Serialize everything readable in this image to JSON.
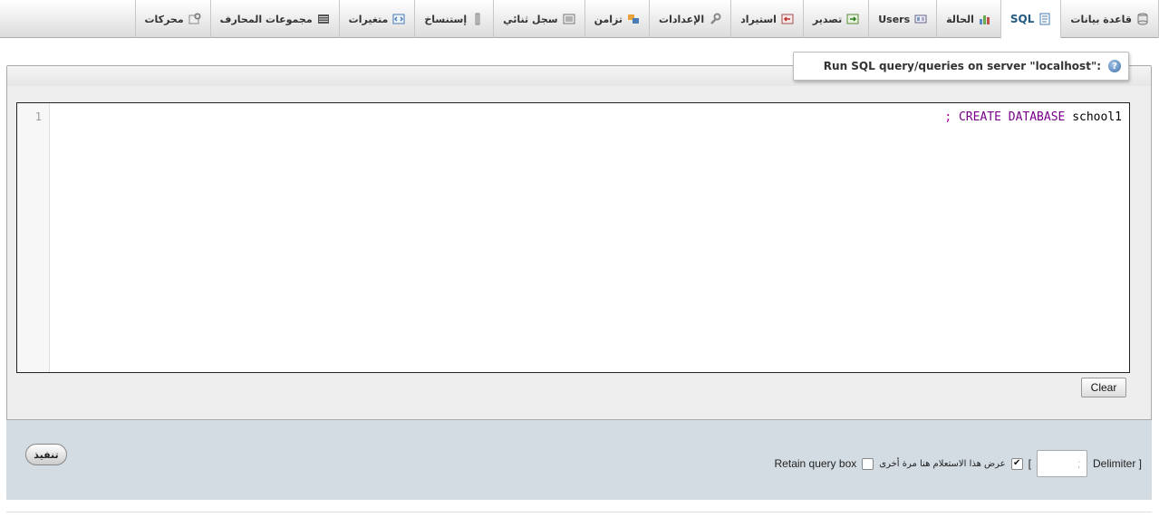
{
  "tabs": [
    {
      "label": "قاعدة بيانات",
      "icon": "database-icon",
      "active": false
    },
    {
      "label": "SQL",
      "icon": "sql-document-icon",
      "active": true
    },
    {
      "label": "الحالة",
      "icon": "status-chart-icon",
      "active": false
    },
    {
      "label": "Users",
      "icon": "users-icon",
      "active": false
    },
    {
      "label": "تصدير",
      "icon": "export-icon",
      "active": false
    },
    {
      "label": "استيراد",
      "icon": "import-icon",
      "active": false
    },
    {
      "label": "الإعدادات",
      "icon": "wrench-icon",
      "active": false
    },
    {
      "label": "تزامن",
      "icon": "sync-icon",
      "active": false
    },
    {
      "label": "سجل ثنائي",
      "icon": "binlog-icon",
      "active": false
    },
    {
      "label": "إستنساخ",
      "icon": "replication-icon",
      "active": false
    },
    {
      "label": "متغيرات",
      "icon": "variables-icon",
      "active": false
    },
    {
      "label": "مجموعات المحارف",
      "icon": "charsets-icon",
      "active": false
    },
    {
      "label": "محركات",
      "icon": "engines-icon",
      "active": false
    }
  ],
  "query_box": {
    "legend": ":\"Run SQL query/queries on server \"localhost",
    "help_glyph": "?",
    "line_numbers": [
      "1"
    ],
    "code": {
      "semicolon": ";",
      "keyword": "CREATE DATABASE",
      "identifier": "school1"
    },
    "clear_label": "Clear"
  },
  "footer": {
    "delimiter_label_open": "[ Delimiter",
    "delimiter_value": ";",
    "bracket_close": "]",
    "show_query_label": "عرض هذا الاستعلام هنا مرة أخرى",
    "show_query_checked": true,
    "retain_label": "Retain query box",
    "retain_checked": false,
    "go_label": "تنفيذ"
  },
  "colors": {
    "active_tab_text": "#235a81",
    "sql_keyword": "#770088",
    "footer_bg": "#d3dce3"
  }
}
